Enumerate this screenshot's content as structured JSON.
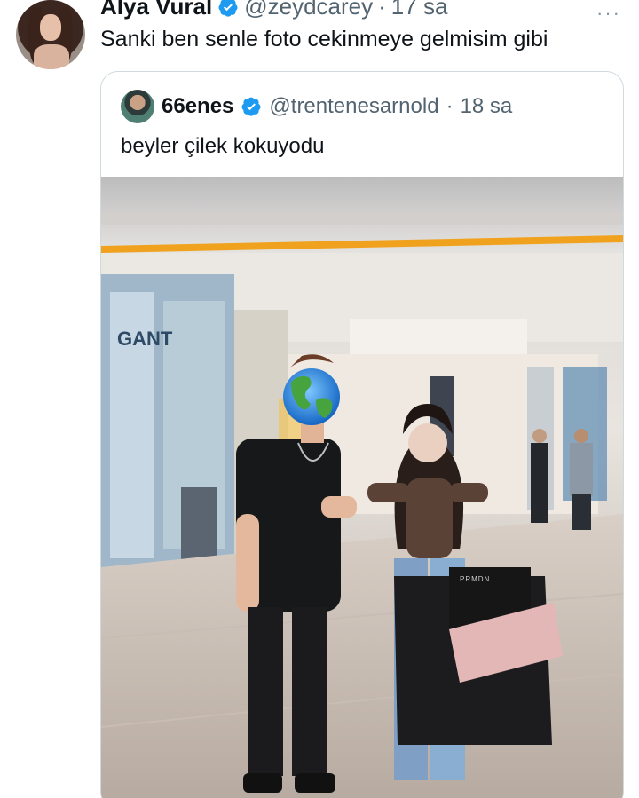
{
  "tweet": {
    "display_name": "Alya Vural",
    "handle": "@zeydcarey",
    "separator": "·",
    "time": "17 sa",
    "more": "···",
    "text": "Sanki ben senle foto cekinmeye gelmisim gibi"
  },
  "quoted": {
    "display_name": "66enes",
    "handle": "@trentenesarnold",
    "separator": "·",
    "time": "18 sa",
    "text": "beyler çilek kokuyodu",
    "photo": {
      "store_sign": "GANT",
      "bag_brand": "PRMDN"
    }
  },
  "colors": {
    "verified": "#1d9bf0",
    "text": "#0f1419",
    "secondary": "#536471",
    "border": "#cfd9de"
  }
}
